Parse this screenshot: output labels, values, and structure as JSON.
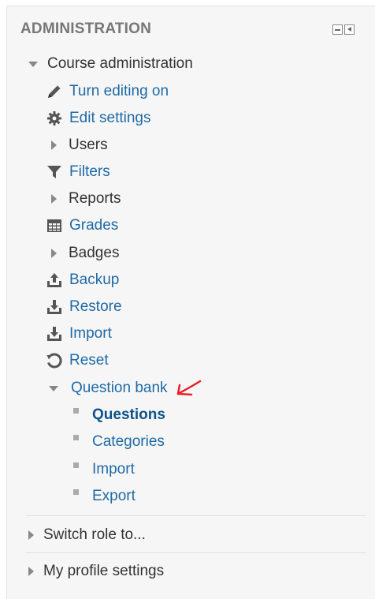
{
  "block": {
    "title": "ADMINISTRATION",
    "course_admin": "Course administration",
    "items": {
      "turn_editing": "Turn editing on",
      "edit_settings": "Edit settings",
      "users": "Users",
      "filters": "Filters",
      "reports": "Reports",
      "grades": "Grades",
      "badges": "Badges",
      "backup": "Backup",
      "restore": "Restore",
      "import": "Import",
      "reset": "Reset",
      "question_bank": "Question bank"
    },
    "question_bank_items": {
      "questions": "Questions",
      "categories": "Categories",
      "import": "Import",
      "export": "Export"
    },
    "switch_role": "Switch role to...",
    "profile_settings": "My profile settings"
  },
  "icons": {
    "turn_editing": "pencil-icon",
    "edit_settings": "gear-icon",
    "filters": "funnel-icon",
    "grades": "table-icon",
    "backup": "upload-icon",
    "restore": "download-icon",
    "import": "download-icon",
    "reset": "refresh-icon"
  },
  "colors": {
    "link": "#1f6aa6",
    "active_link": "#10528a",
    "annotation": "#e8202a"
  }
}
